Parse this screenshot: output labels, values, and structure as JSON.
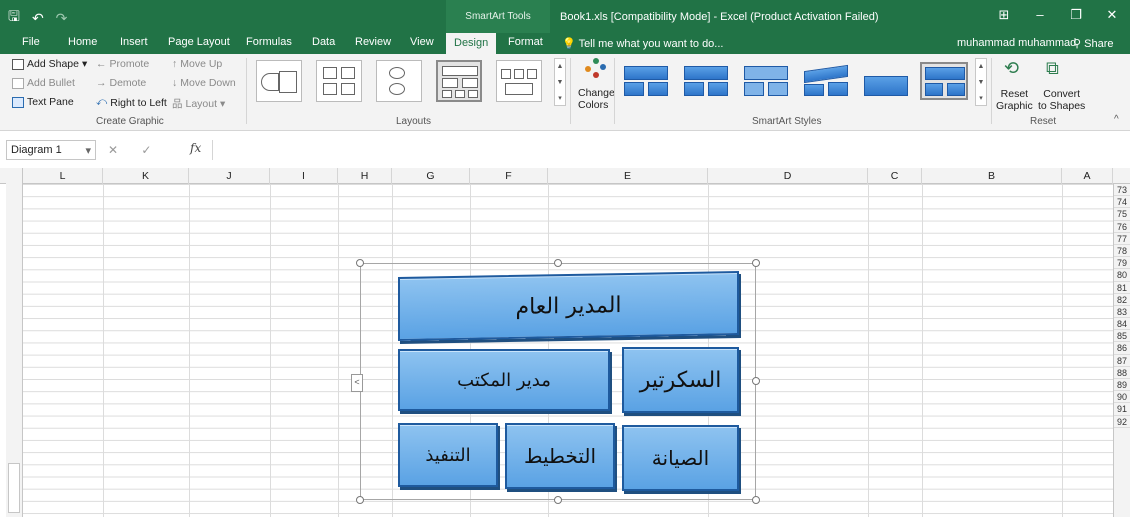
{
  "titlebar": {
    "qat_save": "🖫",
    "qat_undo": "↶",
    "qat_redo": "↷",
    "context_tab": "SmartArt Tools",
    "window_title": "Book1.xls  [Compatibility Mode] - Excel (Product Activation Failed)",
    "ribbon_display": "⊞",
    "minimize": "–",
    "restore": "❐",
    "close": "✕"
  },
  "tabs": {
    "file": "File",
    "home": "Home",
    "insert": "Insert",
    "page_layout": "Page Layout",
    "formulas": "Formulas",
    "data": "Data",
    "review": "Review",
    "view": "View",
    "design": "Design",
    "format": "Format",
    "tell_me": "Tell me what you want to do...",
    "user": "muhammad muhammad",
    "share": "Share"
  },
  "ribbon": {
    "create_graphic": {
      "add_shape": "Add Shape",
      "add_bullet": "Add Bullet",
      "text_pane": "Text Pane",
      "promote": "Promote",
      "demote": "Demote",
      "right_to_left": "Right to Left",
      "move_up": "Move Up",
      "move_down": "Move Down",
      "layout": "Layout",
      "label": "Create Graphic"
    },
    "layouts": {
      "label": "Layouts"
    },
    "change_colors": {
      "line1": "Change",
      "line2": "Colors"
    },
    "styles": {
      "label": "SmartArt Styles"
    },
    "reset": {
      "reset_graphic_1": "Reset",
      "reset_graphic_2": "Graphic",
      "convert_1": "Convert",
      "convert_2": "to Shapes",
      "label": "Reset"
    }
  },
  "formula_bar": {
    "name_box": "Diagram 1",
    "cancel": "✕",
    "enter": "✓",
    "fx": "fx",
    "value": ""
  },
  "columns": [
    "L",
    "K",
    "J",
    "I",
    "H",
    "G",
    "F",
    "E",
    "D",
    "C",
    "B",
    "A"
  ],
  "rows": [
    "73",
    "74",
    "75",
    "76",
    "77",
    "78",
    "79",
    "80",
    "81",
    "82",
    "83",
    "84",
    "85",
    "86",
    "87",
    "88",
    "89",
    "90",
    "91",
    "92"
  ],
  "smartart": {
    "top": "المدير العام",
    "mid_left": "مدير المكتب",
    "mid_right": "السكرتير",
    "bottom_left": "التنفيذ",
    "bottom_mid": "التخطيط",
    "bottom_right": "الصيانة",
    "pane_toggle": "<"
  }
}
